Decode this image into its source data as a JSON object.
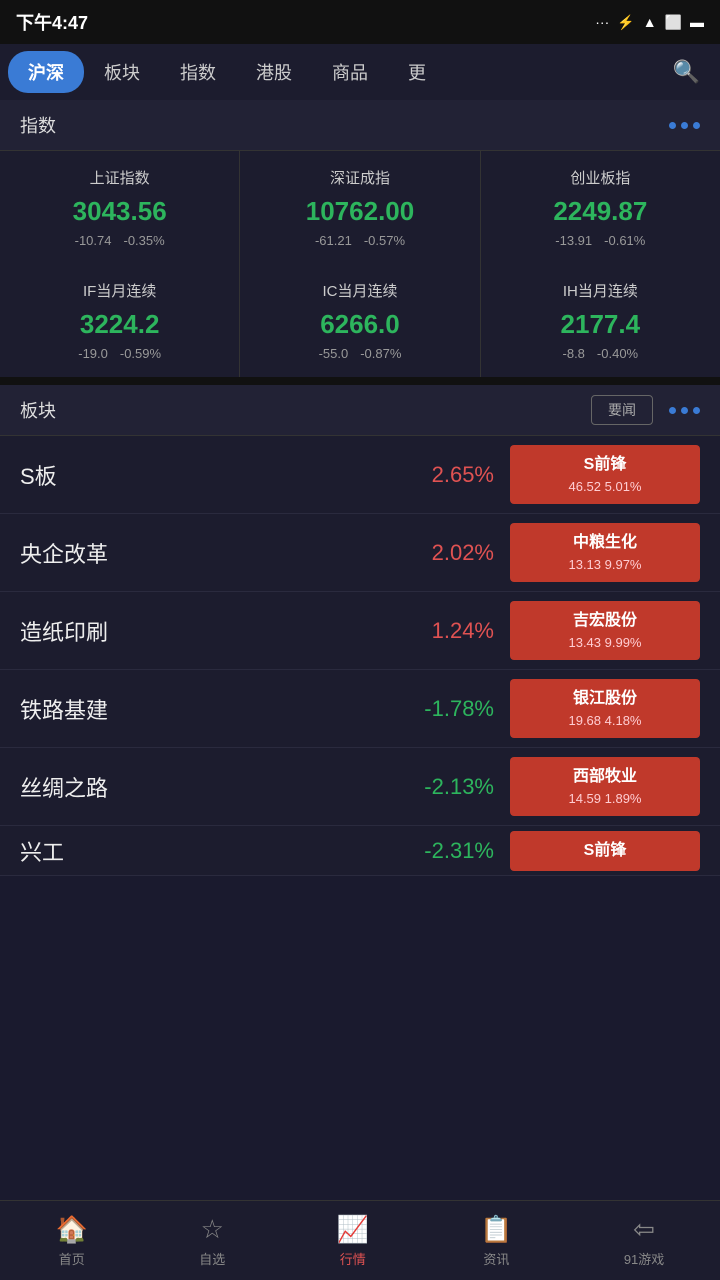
{
  "statusBar": {
    "time": "下午4:47"
  },
  "topNav": {
    "items": [
      "沪深",
      "板块",
      "指数",
      "港股",
      "商品",
      "更"
    ],
    "activeIndex": 0
  },
  "indexSection": {
    "title": "指数",
    "cards": [
      {
        "name": "上证指数",
        "value": "3043.56",
        "change": "-10.74",
        "changePct": "-0.35%"
      },
      {
        "name": "深证成指",
        "value": "10762.00",
        "change": "-61.21",
        "changePct": "-0.57%"
      },
      {
        "name": "创业板指",
        "value": "2249.87",
        "change": "-13.91",
        "changePct": "-0.61%"
      },
      {
        "name": "IF当月连续",
        "value": "3224.2",
        "change": "-19.0",
        "changePct": "-0.59%"
      },
      {
        "name": "IC当月连续",
        "value": "6266.0",
        "change": "-55.0",
        "changePct": "-0.87%"
      },
      {
        "name": "IH当月连续",
        "value": "2177.4",
        "change": "-8.8",
        "changePct": "-0.40%"
      }
    ]
  },
  "sectorSection": {
    "title": "板块",
    "yaolanLabel": "要闻",
    "rows": [
      {
        "name": "S板",
        "change": "2.65%",
        "direction": "up",
        "tagName": "S前锋",
        "tagDetail": "46.52 5.01%"
      },
      {
        "name": "央企改革",
        "change": "2.02%",
        "direction": "up",
        "tagName": "中粮生化",
        "tagDetail": "13.13 9.97%"
      },
      {
        "name": "造纸印刷",
        "change": "1.24%",
        "direction": "up",
        "tagName": "吉宏股份",
        "tagDetail": "13.43 9.99%"
      },
      {
        "name": "铁路基建",
        "change": "-1.78%",
        "direction": "down",
        "tagName": "银江股份",
        "tagDetail": "19.68 4.18%"
      },
      {
        "name": "丝绸之路",
        "change": "-2.13%",
        "direction": "down",
        "tagName": "西部牧业",
        "tagDetail": "14.59 1.89%"
      },
      {
        "name": "兴工",
        "change": "-2.31%",
        "direction": "down",
        "tagName": "S前锋",
        "tagDetail": ""
      }
    ]
  },
  "bottomNav": {
    "items": [
      {
        "label": "首页",
        "icon": "🏠",
        "active": false
      },
      {
        "label": "自选",
        "icon": "☆",
        "active": false
      },
      {
        "label": "行情",
        "icon": "📈",
        "active": true
      },
      {
        "label": "资讯",
        "icon": "📋",
        "active": false
      },
      {
        "label": "91游戏",
        "icon": "⇦",
        "active": false
      }
    ]
  }
}
